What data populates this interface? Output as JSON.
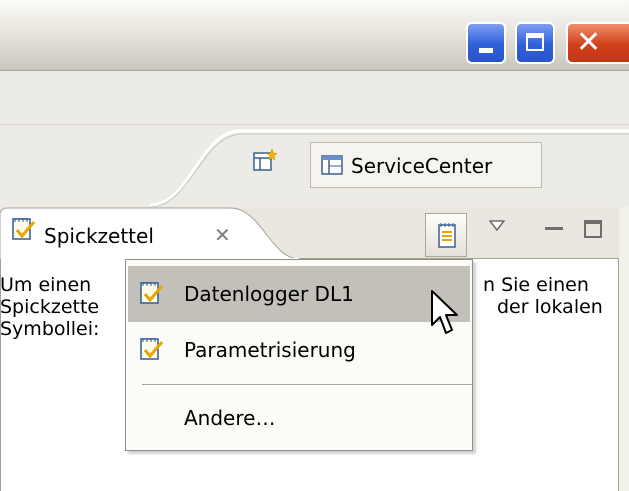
{
  "window": {
    "buttons": {
      "minimize": "minimize",
      "maximize": "maximize",
      "close": "close"
    }
  },
  "perspective": {
    "service_center_label": "ServiceCenter"
  },
  "view": {
    "tab_label": "Spickzettel",
    "content_lines_left": [
      "Um einen",
      "Spickzette",
      "Symbollei:"
    ],
    "content_lines_right": [
      "n Sie einen",
      "der lokalen"
    ]
  },
  "popup_menu": {
    "items": [
      {
        "label": "Datenlogger DL1",
        "highlighted": true
      },
      {
        "label": "Parametrisierung",
        "highlighted": false
      },
      {
        "label": "Andere…",
        "highlighted": false
      }
    ]
  },
  "icons": {
    "cheatsheet": "cheatsheet-icon",
    "open_perspective": "open-perspective-icon",
    "service_center": "perspective-icon",
    "view_menu": "view-menu-icon"
  },
  "colors": {
    "menu_highlight": "#c2c0b9",
    "xp_blue": "#2f5fd9",
    "xp_red": "#d0411a"
  }
}
